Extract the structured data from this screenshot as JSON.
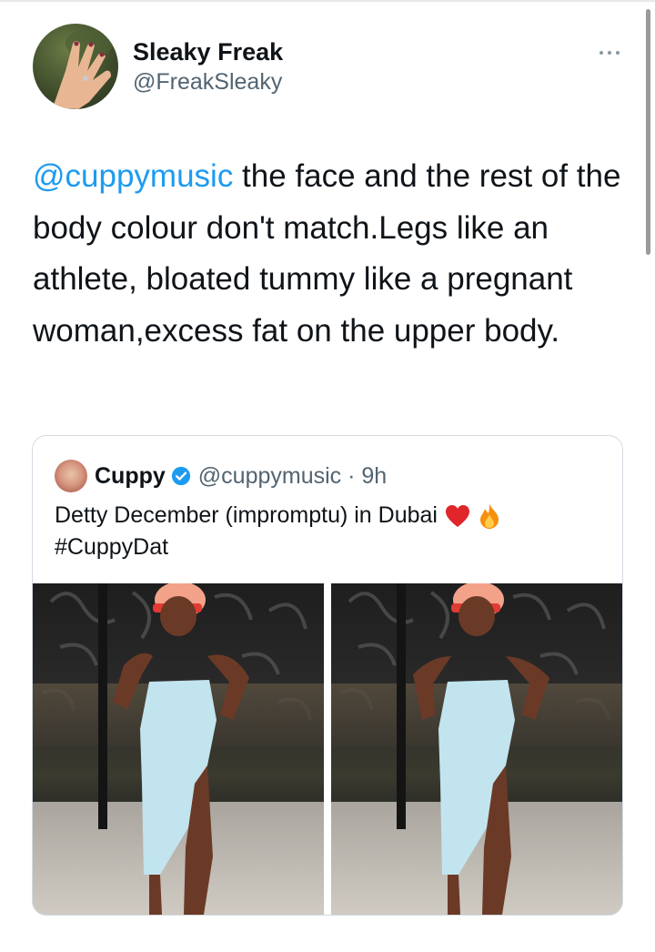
{
  "tweet": {
    "display_name": "Sleaky Freak",
    "handle": "@FreakSleaky",
    "mention": "@cuppymusic",
    "text": " the face  and the rest of the body colour don't match.Legs like an athlete, bloated tummy like a pregnant woman,excess fat on the upper body."
  },
  "quote": {
    "display_name": "Cuppy",
    "handle_time": "@cuppymusic · 9h",
    "text": "Detty December (impromptu) in Dubai",
    "hashtag": "#CuppyDat",
    "emojis": [
      "red-heart",
      "fire"
    ]
  },
  "colors": {
    "link": "#1d9bf0",
    "text": "#0f1419",
    "secondary": "#536471",
    "border": "#d3dbe1",
    "verified": "#1d9bf0"
  }
}
